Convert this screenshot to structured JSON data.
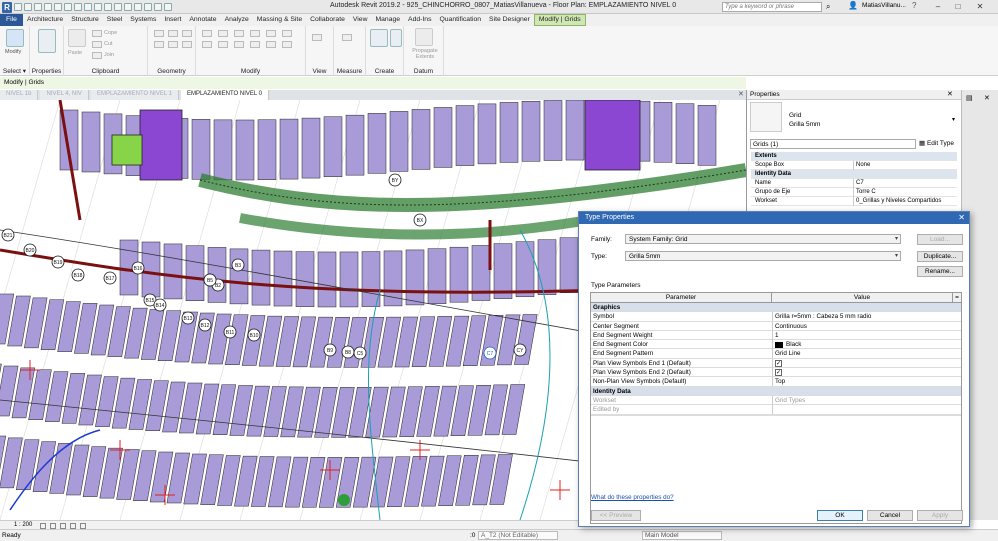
{
  "titlebar": {
    "title": "Autodesk Revit 2019.2 - 925_CHINCHORRO_0807_MatiasVillanueva - Floor Plan: EMPLAZAMIENTO NIVEL 0",
    "search_placeholder": "Type a keyword or phrase",
    "user": "MatiasVillanu...",
    "logo": "R"
  },
  "menu": [
    "File",
    "Architecture",
    "Structure",
    "Steel",
    "Systems",
    "Insert",
    "Annotate",
    "Analyze",
    "Massing & Site",
    "Collaborate",
    "View",
    "Manage",
    "Add-Ins",
    "Quantification",
    "Site Designer",
    "Modify | Grids"
  ],
  "ribbon": {
    "groups": [
      {
        "label": "Select",
        "items": [
          "Modify"
        ]
      },
      {
        "label": "Properties",
        "items": []
      },
      {
        "label": "Clipboard",
        "items": [
          "Paste",
          "Cope",
          "Cut",
          "Join"
        ]
      },
      {
        "label": "Geometry",
        "items": []
      },
      {
        "label": "Modify",
        "items": []
      },
      {
        "label": "View",
        "items": []
      },
      {
        "label": "Measure",
        "items": []
      },
      {
        "label": "Create",
        "items": []
      },
      {
        "label": "Datum",
        "items": [
          "Propagate Extents"
        ]
      }
    ],
    "select_dropdown": "Select ▾"
  },
  "context_bar": "Modify | Grids",
  "view_tabs": [
    {
      "label": "NIVEL 1b",
      "active": false
    },
    {
      "label": "NIVEL 4, NIV",
      "active": false
    },
    {
      "label": "EMPLAZAMIENTO NIVEL 1",
      "active": false
    },
    {
      "label": "EMPLAZAMIENTO NIVEL 0",
      "active": true
    }
  ],
  "properties": {
    "header": "Properties",
    "type_family": "Grid",
    "type_name": "Grilla 5mm",
    "instance_count": "Grids (1)",
    "edit_type": "Edit Type",
    "sections": [
      {
        "name": "Extents",
        "rows": [
          {
            "k": "Scope Box",
            "v": "None"
          }
        ]
      },
      {
        "name": "Identity Data",
        "rows": [
          {
            "k": "Name",
            "v": "C7"
          },
          {
            "k": "Grupo de Eje",
            "v": "Torre C"
          },
          {
            "k": "Workset",
            "v": "0_Grillas y Niveles Compartidos"
          }
        ]
      }
    ]
  },
  "dialog": {
    "title": "Type Properties",
    "close": "✕",
    "family_label": "Family:",
    "family_value": "System Family: Grid",
    "type_label": "Type:",
    "type_value": "Grilla 5mm",
    "load_btn": "Load...",
    "duplicate_btn": "Duplicate...",
    "rename_btn": "Rename...",
    "type_params_label": "Type Parameters",
    "col_param": "Parameter",
    "col_value": "Value",
    "rows": [
      {
        "cat": true,
        "p": "Graphics",
        "v": ""
      },
      {
        "p": "Symbol",
        "v": "Grilla r=5mm : Cabeza 5 mm radio"
      },
      {
        "p": "Center Segment",
        "v": "Continuous"
      },
      {
        "p": "End Segment Weight",
        "v": "1"
      },
      {
        "p": "End Segment Color",
        "v": "Black",
        "swatch": "#000000"
      },
      {
        "p": "End Segment Pattern",
        "v": "Grid Line"
      },
      {
        "p": "Plan View Symbols End 1 (Default)",
        "v": "",
        "check": true
      },
      {
        "p": "Plan View Symbols End 2 (Default)",
        "v": "",
        "check": true
      },
      {
        "p": "Non-Plan View Symbols (Default)",
        "v": "Top"
      },
      {
        "cat": true,
        "p": "Identity Data",
        "v": ""
      },
      {
        "p": "Workset",
        "v": "Grid Types",
        "gray": true
      },
      {
        "p": "Edited by",
        "v": "",
        "gray": true
      }
    ],
    "help_link": "What do these properties do?",
    "preview_btn": "<< Preview",
    "ok_btn": "OK",
    "cancel_btn": "Cancel",
    "apply_btn": "Apply"
  },
  "canvas": {
    "grid_labels": [
      "B21",
      "B20",
      "B19",
      "B18",
      "B17",
      "B16",
      "B15",
      "B14",
      "B13",
      "B12",
      "B11",
      "B10",
      "B9",
      "B8",
      "B1",
      "B2",
      "B3",
      "BY",
      "BX",
      "B5",
      "C5",
      "C7",
      "CY"
    ],
    "scale": "1 : 200"
  },
  "status": {
    "left": "Ready",
    "workset": "A_T2 (Not Editable)",
    "model": "Main Model",
    "zero": ":0"
  },
  "colors": {
    "accent": "#2f68b3",
    "context_green": "#cfe8b3",
    "building_purple": "#9b8ed6",
    "roof_fill": "#a99bd8",
    "wall_red": "#7a1010"
  }
}
